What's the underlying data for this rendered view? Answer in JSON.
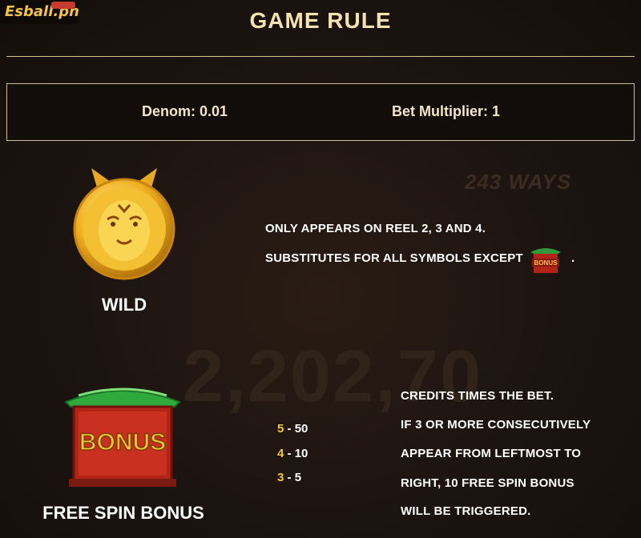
{
  "logo": {
    "text": "Esball.ph"
  },
  "header": {
    "title": "GAME RULE"
  },
  "bet_info": {
    "denom_label": "Denom: 0.01",
    "multiplier_label": "Bet Multiplier: 1"
  },
  "background": {
    "ways_text": "243 WAYS",
    "amount_text": "2,202,70"
  },
  "wild": {
    "label": "WILD",
    "line1": "ONLY APPEARS ON REEL 2, 3 AND 4.",
    "line2": "SUBSTITUTES FOR ALL SYMBOLS EXCEPT",
    "line2_end": ".",
    "icon": "tiger-coin-icon"
  },
  "bonus": {
    "label": "FREE SPIN BONUS",
    "icon": "bonus-gate-icon",
    "icon_text": "BONUS",
    "payouts": [
      {
        "count": "5",
        "sep": " - ",
        "value": "50"
      },
      {
        "count": "4",
        "sep": " - ",
        "value": "10"
      },
      {
        "count": "3",
        "sep": " - ",
        "value": "5"
      }
    ],
    "desc": [
      "CREDITS TIMES THE BET.",
      "IF 3 OR MORE CONSECUTIVELY",
      "APPEAR FROM LEFTMOST TO",
      "RIGHT, 10 FREE SPIN BONUS",
      "WILL BE TRIGGERED."
    ]
  },
  "colors": {
    "gold": "#f5c931",
    "title": "#f4e3b0",
    "background": "#1b1310"
  }
}
